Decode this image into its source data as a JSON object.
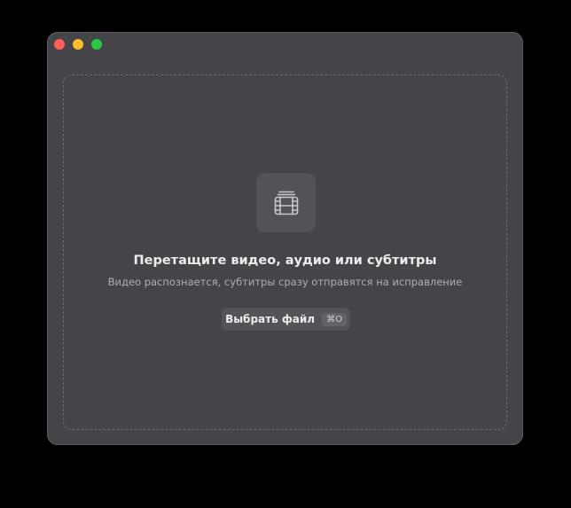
{
  "window": {
    "traffic_lights": {
      "close_color": "#ff5f57",
      "minimize_color": "#febc2e",
      "zoom_color": "#28c840"
    }
  },
  "drop_zone": {
    "icon": "film-icon",
    "title": "Перетащите видео, аудио или субтитры",
    "subtitle": "Видео распознается, субтитры сразу отправятся на исправление",
    "choose_button": {
      "label": "Выбрать файл",
      "shortcut": "⌘O"
    }
  }
}
